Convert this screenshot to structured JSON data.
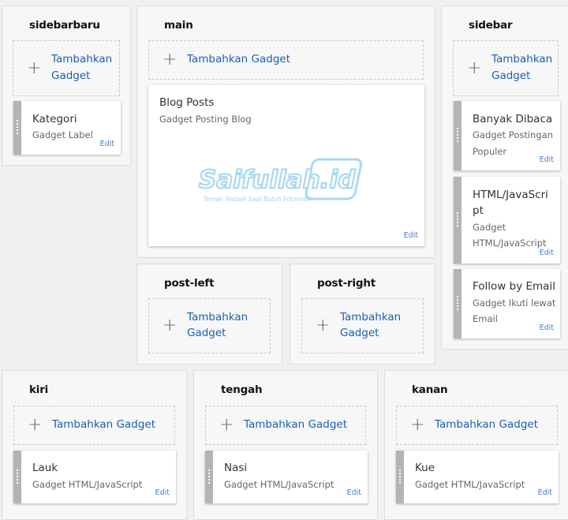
{
  "add_gadget_label": "Tambahkan Gadget",
  "edit_label": "Edit",
  "colors": {
    "accent": "#1a5fb4",
    "watermark": "#a9d9f2"
  },
  "watermark": {
    "brand": "Saifullah.id",
    "tagline": "Teman Terbaik Saat Butuh Informasi"
  },
  "sections": {
    "sidebarbaru": {
      "title": "sidebarbaru",
      "add_label_1": "Tambahkan",
      "add_label_2": "Gadget",
      "gadgets": [
        {
          "title": "Kategori",
          "subtitle": "Gadget Label"
        }
      ]
    },
    "main": {
      "title": "main",
      "gadgets": [
        {
          "title": "Blog Posts",
          "subtitle": "Gadget Posting Blog"
        }
      ]
    },
    "sidebar": {
      "title": "sidebar",
      "add_label_1": "Tambahkan",
      "add_label_2": "Gadget",
      "gadgets": [
        {
          "title": "Banyak Dibaca",
          "subtitle_1": "Gadget Postingan",
          "subtitle_2": "Populer"
        },
        {
          "title_1": "HTML/JavaScri",
          "title_2": "pt",
          "subtitle_1": "Gadget",
          "subtitle_2": "HTML/JavaScript"
        },
        {
          "title": "Follow by Email",
          "subtitle_1": "Gadget Ikuti lewat",
          "subtitle_2": "Email"
        }
      ]
    },
    "post_left": {
      "title": "post-left",
      "add_label_1": "Tambahkan",
      "add_label_2": "Gadget"
    },
    "post_right": {
      "title": "post-right",
      "add_label_1": "Tambahkan",
      "add_label_2": "Gadget"
    },
    "kiri": {
      "title": "kiri",
      "gadgets": [
        {
          "title": "Lauk",
          "subtitle": "Gadget HTML/JavaScript"
        }
      ]
    },
    "tengah": {
      "title": "tengah",
      "gadgets": [
        {
          "title": "Nasi",
          "subtitle": "Gadget HTML/JavaScript"
        }
      ]
    },
    "kanan": {
      "title": "kanan",
      "gadgets": [
        {
          "title": "Kue",
          "subtitle": "Gadget HTML/JavaScript"
        }
      ]
    }
  }
}
